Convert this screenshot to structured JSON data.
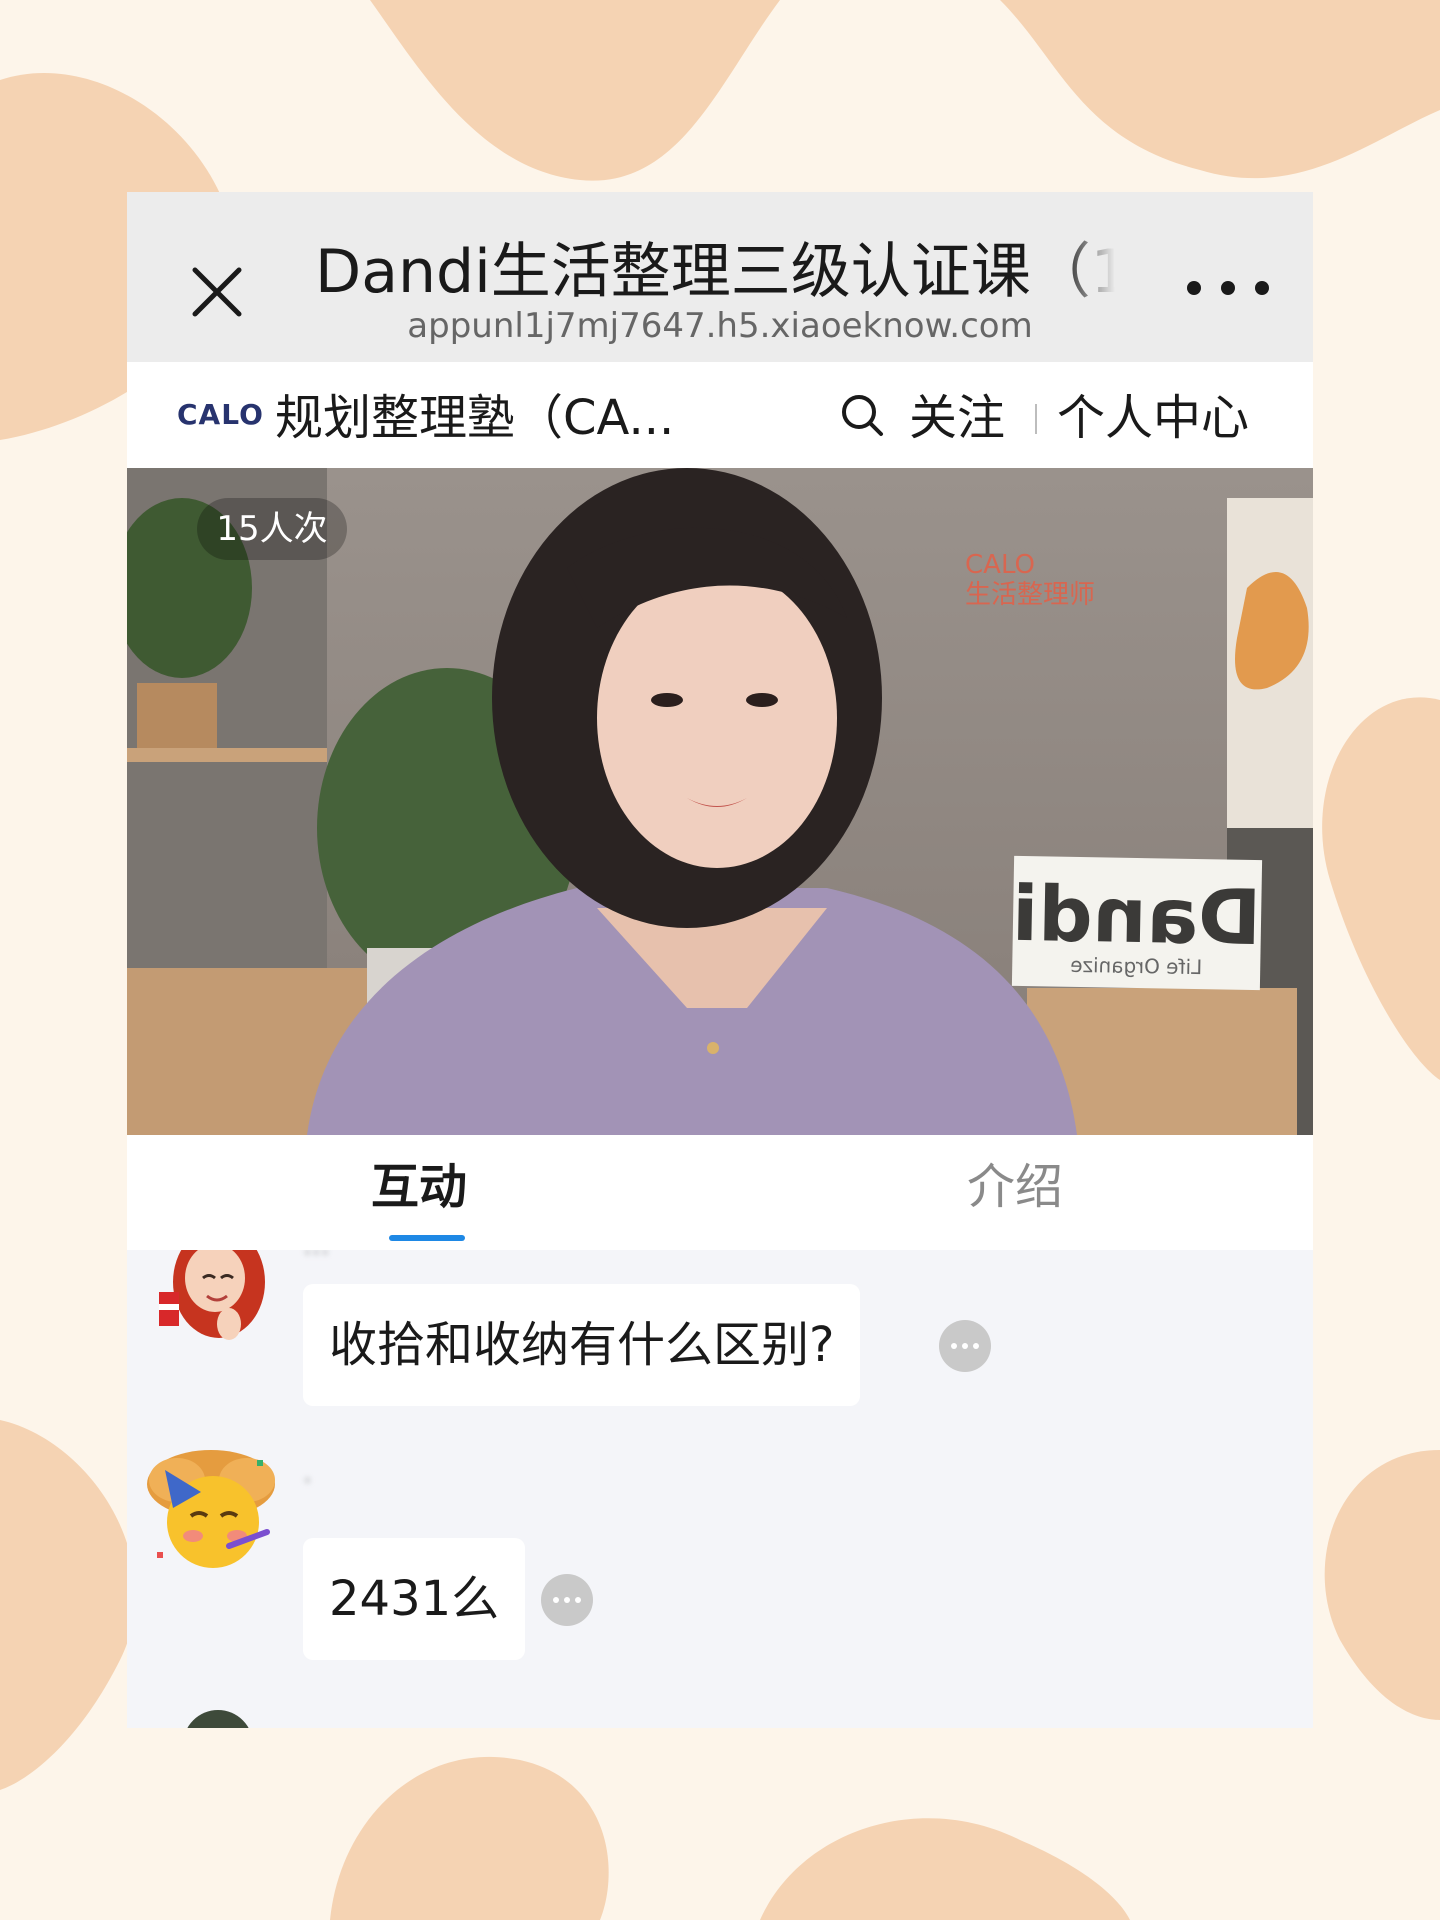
{
  "browser": {
    "title": "Dandi生活整理三级认证课（1",
    "url": "appunl1j7mj7647.h5.xiaoeknow.com",
    "close_icon": "close-icon",
    "more_icon": "more-dots-icon"
  },
  "header": {
    "logo_text": "CALO",
    "shop_name": "规划整理塾（CA...",
    "search_icon": "search-icon",
    "follow_label": "关注",
    "profile_label": "个人中心"
  },
  "video": {
    "viewer_count": "15人次"
  },
  "tabs": [
    {
      "label": "互动",
      "active": true
    },
    {
      "label": "介绍",
      "active": false
    }
  ],
  "chat": {
    "messages": [
      {
        "text": "收拾和收纳有什么区别?",
        "avatar": "memoji-avatar"
      },
      {
        "text": "2431么",
        "avatar": "party-face-avatar"
      }
    ]
  },
  "colors": {
    "page_background": "#fdf5ea",
    "blob": "#f5d3b3",
    "title_bar": "#ececec",
    "chat_background": "#f4f5f9",
    "tab_indicator": "#1e88e5",
    "brand": "#27336e"
  }
}
